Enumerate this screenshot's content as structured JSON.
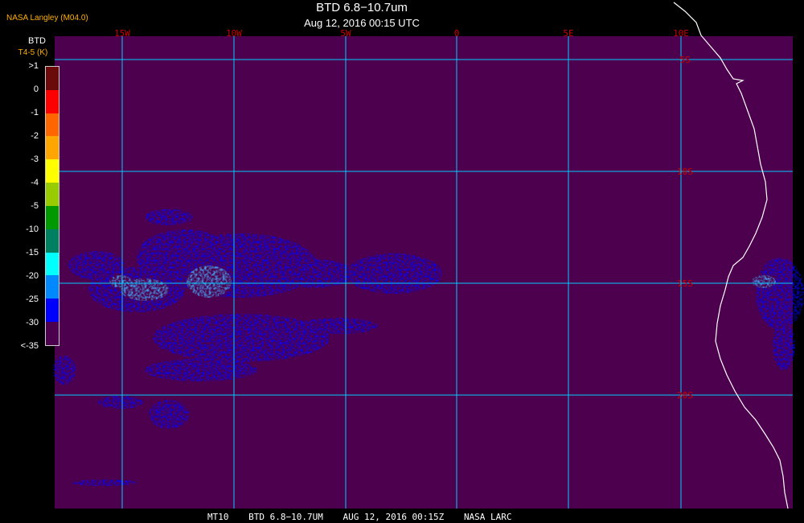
{
  "header": {
    "credit": "NASA Langley (M04.0)",
    "title": "BTD 6.8−10.7um",
    "subtitle": "Aug 12, 2016 00:15 UTC"
  },
  "legend": {
    "title": "BTD",
    "units": "T4-5 (K)",
    "labels": [
      ">1",
      "0",
      "-1",
      "-2",
      "-3",
      "-4",
      "-5",
      "-10",
      "-15",
      "-20",
      "-25",
      "-30",
      "<-35"
    ],
    "colors": [
      "#6a0a0a",
      "#ff0000",
      "#ff6600",
      "#ffa500",
      "#ffff00",
      "#99cc00",
      "#009900",
      "#008060",
      "#00ffff",
      "#0088ff",
      "#0000ff",
      "#4d004d"
    ]
  },
  "map": {
    "background_color": "#4d004d",
    "grid_color": "#00ccff",
    "coast_color": "#ffffff",
    "lon_label_color": "#cc0000",
    "lat_label_color": "#cc0000",
    "longitude_labels": [
      "15W",
      "10W",
      "5W",
      "0",
      "5E",
      "10E"
    ],
    "latitude_labels": [
      "5S",
      "10S",
      "15S",
      "20S"
    ],
    "cloud_color": "#0000ff",
    "cloud_light_color": "#44aaff"
  },
  "footer": {
    "items": [
      "MT10",
      "BTD 6.8−10.7UM",
      "AUG 12, 2016 00:15Z",
      "NASA LARC"
    ]
  }
}
